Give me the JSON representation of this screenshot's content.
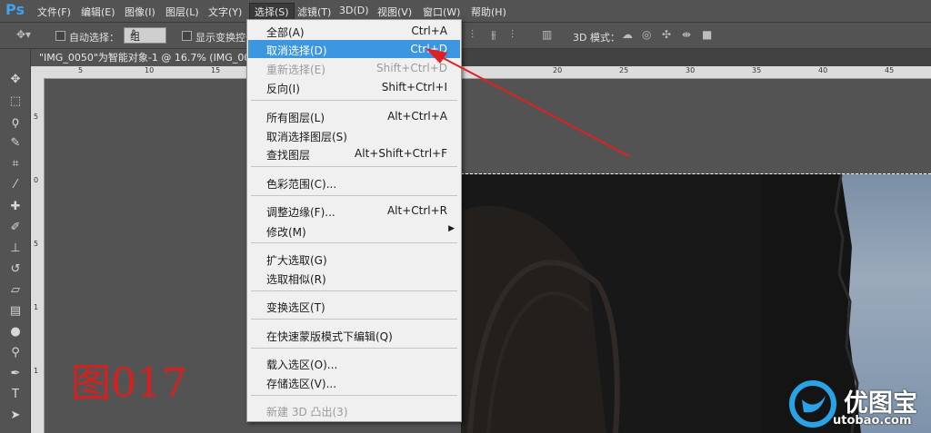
{
  "app": {
    "logo": "Ps"
  },
  "menubar": {
    "items": [
      "文件(F)",
      "编辑(E)",
      "图像(I)",
      "图层(L)",
      "文字(Y)",
      "选择(S)",
      "滤镜(T)",
      "3D(D)",
      "视图(V)",
      "窗口(W)",
      "帮助(H)"
    ],
    "active": "选择(S)"
  },
  "options_bar": {
    "auto_select_label": "自动选择：",
    "auto_select_value": "组",
    "show_transform_label": "显示变换控件",
    "mode_3d_label": "3D 模式："
  },
  "document_tab": {
    "title": "\"IMG_0050\"为智能对象-1 @ 16.7% (IMG_0050"
  },
  "ruler": {
    "h_labels": [
      "5",
      "10",
      "15",
      "20",
      "25",
      "30",
      "35",
      "40",
      "45",
      "50"
    ],
    "v_labels": [
      "5",
      "0",
      "5",
      "1",
      "1",
      "2",
      "2",
      "3",
      "3",
      "4"
    ]
  },
  "select_menu": {
    "items": [
      {
        "label": "全部(A)",
        "shortcut": "Ctrl+A",
        "state": "normal"
      },
      {
        "label": "取消选择(D)",
        "shortcut": "Ctrl+D",
        "state": "highlighted"
      },
      {
        "label": "重新选择(E)",
        "shortcut": "Shift+Ctrl+D",
        "state": "disabled"
      },
      {
        "label": "反向(I)",
        "shortcut": "Shift+Ctrl+I",
        "state": "normal"
      },
      {
        "label": "所有图层(L)",
        "shortcut": "Alt+Ctrl+A",
        "state": "normal"
      },
      {
        "label": "取消选择图层(S)",
        "shortcut": "",
        "state": "normal"
      },
      {
        "label": "查找图层",
        "shortcut": "Alt+Shift+Ctrl+F",
        "state": "normal"
      },
      {
        "label": "色彩范围(C)...",
        "shortcut": "",
        "state": "normal"
      },
      {
        "label": "调整边缘(F)...",
        "shortcut": "Alt+Ctrl+R",
        "state": "normal"
      },
      {
        "label": "修改(M)",
        "shortcut": "",
        "state": "normal",
        "submenu": true
      },
      {
        "label": "扩大选取(G)",
        "shortcut": "",
        "state": "normal"
      },
      {
        "label": "选取相似(R)",
        "shortcut": "",
        "state": "normal"
      },
      {
        "label": "变换选区(T)",
        "shortcut": "",
        "state": "normal"
      },
      {
        "label": "在快速蒙版模式下编辑(Q)",
        "shortcut": "",
        "state": "normal"
      },
      {
        "label": "载入选区(O)...",
        "shortcut": "",
        "state": "normal"
      },
      {
        "label": "存储选区(V)...",
        "shortcut": "",
        "state": "normal"
      },
      {
        "label": "新建 3D 凸出(3)",
        "shortcut": "",
        "state": "disabled"
      }
    ]
  },
  "annotation": {
    "figure_label": "图017",
    "arrow_color": "#e02020"
  },
  "watermark": {
    "brand": "优图宝",
    "domain": "utobao.com"
  },
  "colors": {
    "highlight": "#3d96e0",
    "ps_blue": "#3ea3f2",
    "label_red": "#d42020"
  }
}
